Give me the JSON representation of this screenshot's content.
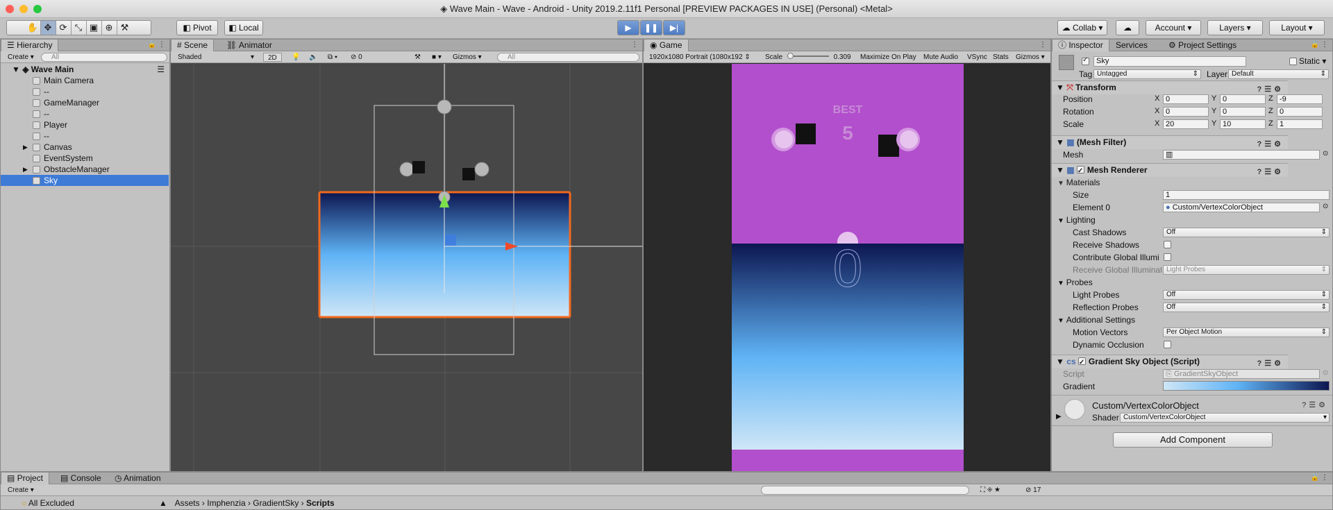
{
  "window": {
    "title": "Wave Main - Wave - Android - Unity 2019.2.11f1 Personal [PREVIEW PACKAGES IN USE] (Personal) <Metal>"
  },
  "toolbar": {
    "tools": [
      "hand-tool",
      "move-tool",
      "rotate-tool",
      "scale-tool",
      "rect-tool",
      "transform-tool",
      "custom-tool"
    ],
    "pivot_label": "Pivot",
    "local_label": "Local",
    "collab_label": "Collab",
    "account_label": "Account",
    "layers_label": "Layers",
    "layout_label": "Layout"
  },
  "hierarchy": {
    "tab_label": "Hierarchy",
    "create_label": "Create",
    "search_placeholder": "All",
    "scene_name": "Wave Main",
    "items": [
      {
        "label": "Main Camera",
        "arrow": ""
      },
      {
        "label": "--",
        "arrow": ""
      },
      {
        "label": "GameManager",
        "arrow": ""
      },
      {
        "label": "--",
        "arrow": ""
      },
      {
        "label": "Player",
        "arrow": ""
      },
      {
        "label": "--",
        "arrow": ""
      },
      {
        "label": "Canvas",
        "arrow": "▶"
      },
      {
        "label": "EventSystem",
        "arrow": ""
      },
      {
        "label": "ObstacleManager",
        "arrow": "▶"
      },
      {
        "label": "Sky",
        "arrow": "",
        "selected": true
      }
    ]
  },
  "scene": {
    "tab_scene": "Scene",
    "tab_animator": "Animator",
    "shading_mode": "Shaded",
    "mode_2d": "2D",
    "effects_count": "0",
    "gizmos_label": "Gizmos",
    "search_placeholder": "All"
  },
  "game": {
    "tab_label": "Game",
    "resolution": "1920x1080 Portrait (1080x192",
    "scale_label": "Scale",
    "scale_value": "0.309",
    "maximize_label": "Maximize On Play",
    "mute_label": "Mute Audio",
    "vsync_label": "VSync",
    "stats_label": "Stats",
    "gizmos_label": "Gizmos",
    "best_label": "BEST",
    "best_value": "5",
    "score_value": "0",
    "colors": {
      "top": "#b24fcc",
      "sky_top": "#0c1650",
      "sky_mid": "#5fb3f5",
      "sky_bottom": "#cfe6f7"
    }
  },
  "inspector": {
    "tab_inspector": "Inspector",
    "tab_services": "Services",
    "tab_project_settings": "Project Settings",
    "object_name": "Sky",
    "static_label": "Static",
    "tag_label": "Tag",
    "tag_value": "Untagged",
    "layer_label": "Layer",
    "layer_value": "Default",
    "transform": {
      "title": "Transform",
      "position_label": "Position",
      "position": {
        "x": "0",
        "y": "0",
        "z": "-9"
      },
      "rotation_label": "Rotation",
      "rotation": {
        "x": "0",
        "y": "0",
        "z": "0"
      },
      "scale_label": "Scale",
      "scale": {
        "x": "20",
        "y": "10",
        "z": "1"
      }
    },
    "mesh_filter": {
      "title": "(Mesh Filter)",
      "mesh_label": "Mesh"
    },
    "mesh_renderer": {
      "title": "Mesh Renderer",
      "materials_label": "Materials",
      "size_label": "Size",
      "size_value": "1",
      "element0_label": "Element 0",
      "element0_value": "Custom/VertexColorObject",
      "lighting_label": "Lighting",
      "cast_shadows_label": "Cast Shadows",
      "cast_shadows_value": "Off",
      "receive_shadows_label": "Receive Shadows",
      "contribute_gi_label": "Contribute Global Illumi",
      "receive_gi_label": "Receive Global Illuminati",
      "receive_gi_value": "Light Probes",
      "probes_label": "Probes",
      "light_probes_label": "Light Probes",
      "light_probes_value": "Off",
      "reflection_probes_label": "Reflection Probes",
      "reflection_probes_value": "Off",
      "additional_label": "Additional Settings",
      "motion_vectors_label": "Motion Vectors",
      "motion_vectors_value": "Per Object Motion",
      "dynamic_occlusion_label": "Dynamic Occlusion"
    },
    "gradient_sky": {
      "title": "Gradient Sky Object (Script)",
      "script_label": "Script",
      "script_value": "GradientSkyObject",
      "gradient_label": "Gradient"
    },
    "material": {
      "name": "Custom/VertexColorObject",
      "shader_label": "Shader",
      "shader_value": "Custom/VertexColorObject"
    },
    "add_component_label": "Add Component"
  },
  "project": {
    "tab_project": "Project",
    "tab_console": "Console",
    "tab_animation": "Animation",
    "create_label": "Create",
    "filter_label": "All Excluded",
    "breadcrumb": [
      "Assets",
      "Imphenzia",
      "GradientSky",
      "Scripts"
    ],
    "hidden_count": "17"
  }
}
